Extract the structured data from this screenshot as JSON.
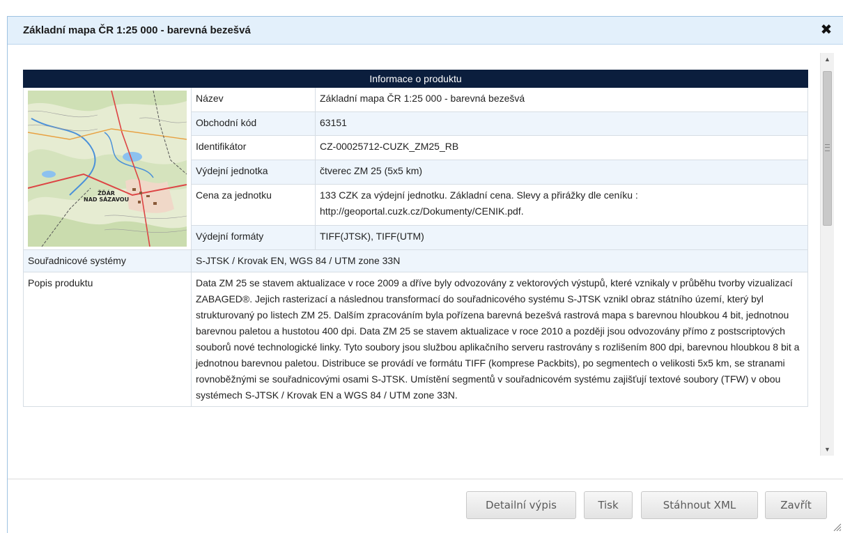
{
  "dialog": {
    "title": "Základní mapa ČR 1:25 000 - barevná bezešvá",
    "close_icon": "close-icon"
  },
  "info_table": {
    "header": "Informace o produktu",
    "rows": [
      {
        "label": "Název",
        "value": "Základní mapa ČR 1:25 000 - barevná bezešvá"
      },
      {
        "label": "Obchodní kód",
        "value": "63151"
      },
      {
        "label": "Identifikátor",
        "value": "CZ-00025712-CUZK_ZM25_RB"
      },
      {
        "label": "Výdejní jednotka",
        "value": "čtverec ZM 25 (5x5 km)"
      },
      {
        "label": "Cena za jednotku",
        "value": "133 CZK za výdejní jednotku. Základní cena. Slevy a přirážky dle ceníku : http://geoportal.cuzk.cz/Dokumenty/CENIK.pdf."
      },
      {
        "label": "Výdejní formáty",
        "value": "TIFF(JTSK), TIFF(UTM)"
      }
    ],
    "coord": {
      "label": "Souřadnicové systémy",
      "value": "S-JTSK / Krovak EN, WGS 84 / UTM zone 33N"
    },
    "desc": {
      "label": "Popis produktu",
      "value": "Data ZM 25 se stavem aktualizace v roce 2009 a dříve byly odvozovány z vektorových výstupů, které vznikaly v průběhu tvorby vizualizací ZABAGED®. Jejich rasterizací a následnou transformací do souřadnicového systému S-JTSK vznikl obraz státního území, který byl strukturovaný po listech ZM 25. Dalším zpracováním byla pořízena barevná bezešvá rastrová mapa s barevnou hloubkou 4 bit, jednotnou barevnou paletou a hustotou 400 dpi. Data ZM 25 se stavem aktualizace v roce 2010 a později jsou odvozovány přímo z postscriptových souborů nové technologické linky. Tyto soubory jsou službou aplikačního serveru rastrovány s rozlišením 800 dpi, barevnou hloubkou 8 bit a jednotnou barevnou paletou. Distribuce se provádí ve formátu TIFF (komprese Packbits), po segmentech o velikosti 5x5 km, se stranami rovnoběžnými se souřadnicovými osami S-JTSK. Umístění segmentů v souřadnicovém systému zajišťují textové soubory (TFW) v obou systémech S-JTSK / Krovak EN a WGS 84 / UTM zone 33N."
    },
    "map_label_line1": "ŽĎÁR",
    "map_label_line2": "NAD SÁZAVOU"
  },
  "buttons": {
    "detail": "Detailní výpis",
    "print": "Tisk",
    "xml": "Stáhnout XML",
    "close": "Zavřít"
  },
  "colors": {
    "header_bg": "#0b1e3d",
    "titlebar_bg": "#e3f0fb",
    "alt_row": "#eef5fc"
  }
}
